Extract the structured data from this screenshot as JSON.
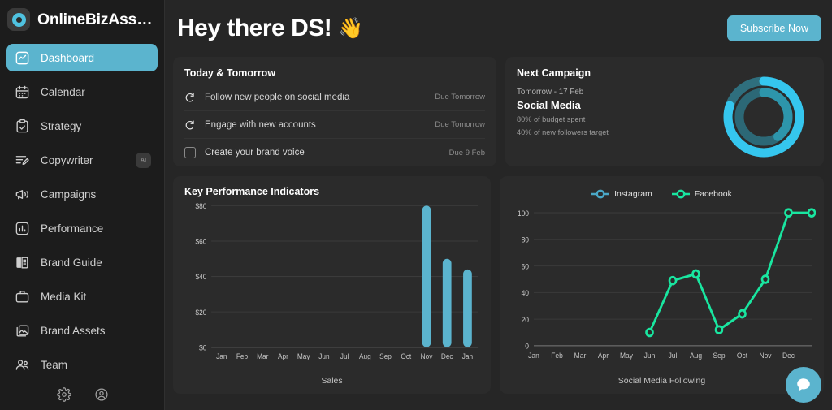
{
  "brand": {
    "name": "OnlineBizAss…",
    "logo_icon": "circle-ring-logo"
  },
  "sidebar": {
    "items": [
      {
        "label": "Dashboard",
        "icon": "chart-line-icon",
        "active": true,
        "badge": null
      },
      {
        "label": "Calendar",
        "icon": "calendar-icon",
        "active": false,
        "badge": null
      },
      {
        "label": "Strategy",
        "icon": "clipboard-check-icon",
        "active": false,
        "badge": null
      },
      {
        "label": "Copywriter",
        "icon": "pencil-lines-icon",
        "active": false,
        "badge": "AI"
      },
      {
        "label": "Campaigns",
        "icon": "megaphone-icon",
        "active": false,
        "badge": null
      },
      {
        "label": "Performance",
        "icon": "bar-chart-icon",
        "active": false,
        "badge": null
      },
      {
        "label": "Brand Guide",
        "icon": "book-icon",
        "active": false,
        "badge": null
      },
      {
        "label": "Media Kit",
        "icon": "briefcase-icon",
        "active": false,
        "badge": null
      },
      {
        "label": "Brand Assets",
        "icon": "image-stack-icon",
        "active": false,
        "badge": null
      },
      {
        "label": "Team",
        "icon": "users-icon",
        "active": false,
        "badge": null
      }
    ],
    "footer_icons": [
      {
        "name": "settings-gear-icon"
      },
      {
        "name": "user-circle-icon"
      }
    ]
  },
  "header": {
    "greeting": "Hey there DS!",
    "wave_emoji": "👋",
    "subscribe_label": "Subscribe Now"
  },
  "today_card": {
    "title": "Today & Tomorrow",
    "tasks": [
      {
        "name": "Follow new people on social media",
        "due": "Due Tomorrow",
        "control": "repeat-icon"
      },
      {
        "name": "Engage with new accounts",
        "due": "Due Tomorrow",
        "control": "repeat-icon"
      },
      {
        "name": "Create your brand voice",
        "due": "Due 9 Feb",
        "control": "checkbox"
      }
    ]
  },
  "campaign_card": {
    "title": "Next Campaign",
    "date": "Tomorrow - 17 Feb",
    "type": "Social Media",
    "stat_budget": "80% of budget spent",
    "stat_followers": "40% of new followers target",
    "donut": {
      "outer_value": 80,
      "outer_color": "#35c6ee",
      "outer_track": "#2f6f7e",
      "inner_value": 40,
      "inner_color": "#2d95ab",
      "inner_track": "#2c6876"
    }
  },
  "kpi_card": {
    "title": "Key Performance Indicators"
  },
  "chat": {
    "icon": "chat-bubble-icon",
    "color": "#5bb4ce"
  },
  "colors": {
    "accent": "#5bb4ce",
    "page_bg": "#262626",
    "card_bg": "#2b2b2b",
    "sidebar_bg": "#1c1c1c",
    "instagram": "#4aa7c6",
    "facebook": "#19e6a0"
  },
  "chart_data": [
    {
      "type": "bar",
      "title": "Key Performance Indicators",
      "xlabel": "Sales",
      "ylabel": "",
      "categories": [
        "Jan",
        "Feb",
        "Mar",
        "Apr",
        "May",
        "Jun",
        "Jul",
        "Aug",
        "Sep",
        "Oct",
        "Nov",
        "Dec",
        "Jan"
      ],
      "values": [
        0,
        0,
        0,
        0,
        0,
        0,
        0,
        0,
        0,
        0,
        80,
        50,
        44
      ],
      "ytick_labels": [
        "$0",
        "$20",
        "$40",
        "$60",
        "$80"
      ],
      "yticks": [
        0,
        20,
        40,
        60,
        80
      ],
      "ylim": [
        0,
        80
      ],
      "bar_color": "#5bb4ce",
      "grid": true,
      "legend": "none"
    },
    {
      "type": "line",
      "title": "",
      "xlabel": "Social Media Following",
      "ylabel": "",
      "categories": [
        "Jan",
        "Feb",
        "Mar",
        "Apr",
        "May",
        "Jun",
        "Jul",
        "Aug",
        "Sep",
        "Oct",
        "Nov",
        "Dec",
        ""
      ],
      "ytick_labels": [
        "0",
        "20",
        "40",
        "60",
        "80",
        "100"
      ],
      "yticks": [
        0,
        20,
        40,
        60,
        80,
        100
      ],
      "ylim": [
        0,
        100
      ],
      "grid": true,
      "legend": "top-center",
      "series": [
        {
          "name": "Instagram",
          "color": "#4aa7c6",
          "values": [
            null,
            null,
            null,
            null,
            null,
            null,
            null,
            null,
            null,
            null,
            null,
            null,
            null
          ]
        },
        {
          "name": "Facebook",
          "color": "#19e6a0",
          "values": [
            null,
            null,
            null,
            null,
            null,
            10,
            49,
            54,
            12,
            24,
            50,
            100,
            100
          ]
        }
      ]
    }
  ]
}
